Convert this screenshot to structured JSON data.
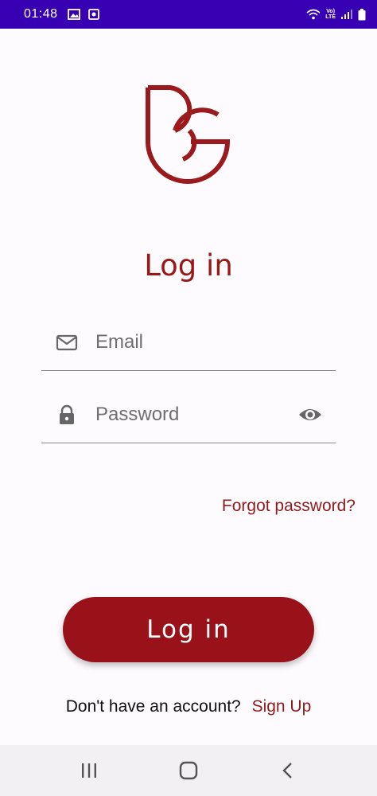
{
  "status_bar": {
    "time": "01:48",
    "network_label_top": "Vo)",
    "network_label_bottom": "LTE"
  },
  "colors": {
    "brand": "#99121a",
    "accent_text": "#8e1c1c",
    "status_bar": "#3700b3"
  },
  "icons": {
    "email": "mail-icon",
    "password": "lock-icon",
    "visibility": "eye-icon"
  },
  "login": {
    "title": "Log in",
    "email_placeholder": "Email",
    "password_placeholder": "Password",
    "forgot_password": "Forgot password?",
    "button_label": "Log in",
    "signup_prompt": "Don't have an account?",
    "signup_link": "Sign Up"
  }
}
